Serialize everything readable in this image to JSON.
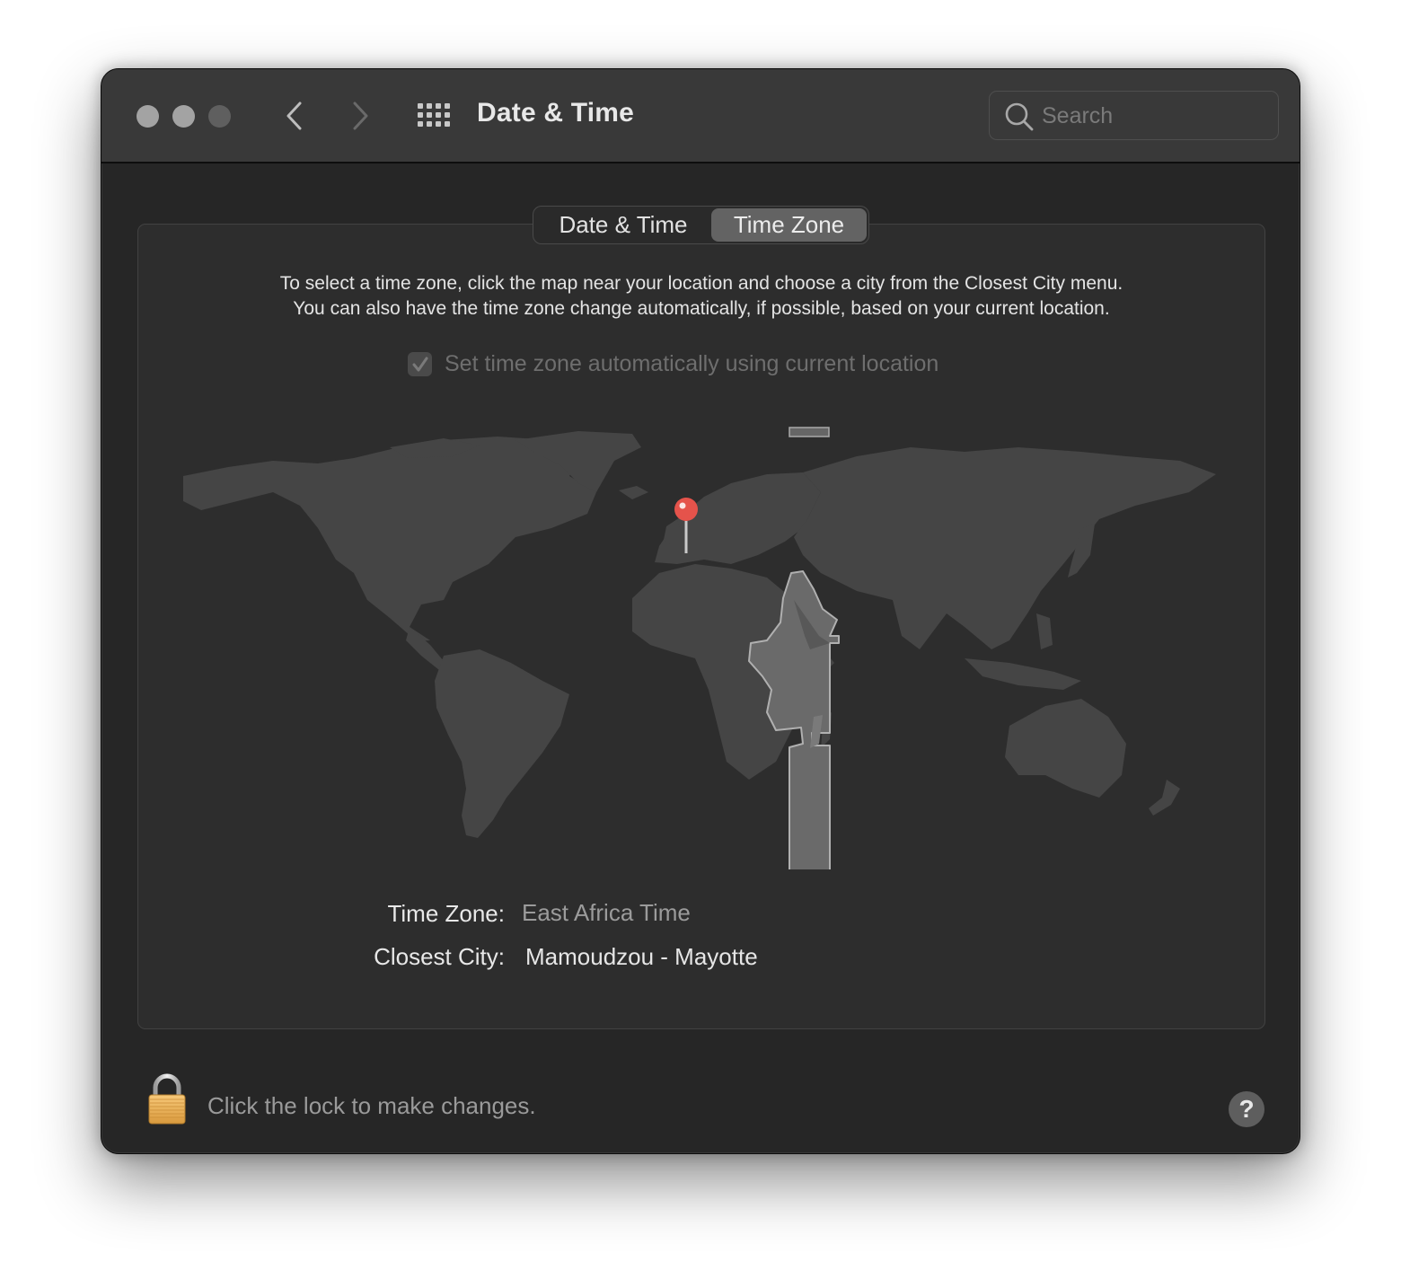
{
  "window": {
    "title": "Date & Time",
    "traffic_lights": [
      "close",
      "minimize",
      "zoom"
    ]
  },
  "toolbar": {
    "back_icon": "chevron-left-icon",
    "forward_icon": "chevron-right-icon",
    "grid_icon": "show-all-grid-icon",
    "search_placeholder": "Search",
    "search_value": ""
  },
  "tabs": [
    {
      "label": "Date & Time",
      "active": false
    },
    {
      "label": "Time Zone",
      "active": true
    }
  ],
  "time_zone_pane": {
    "description_line1": "To select a time zone, click the map near your location and choose a city from the Closest City menu.",
    "description_line2": "You can also have the time zone change automatically, if possible, based on your current location.",
    "auto_checkbox": {
      "label": "Set time zone automatically using current location",
      "checked": true,
      "enabled": false
    },
    "map": {
      "pin_color": "#e5534b",
      "highlight_zone": "East Africa Time"
    },
    "time_zone_label": "Time Zone:",
    "time_zone_value": "East Africa Time",
    "closest_city_label": "Closest City:",
    "closest_city_value": "Mamoudzou - Mayotte"
  },
  "footer": {
    "lock_text": "Click the lock to make changes.",
    "lock_icon": "padlock-icon",
    "help_label": "?"
  },
  "colors": {
    "window_bg": "#262626",
    "titlebar_bg": "#393939",
    "panel_bg": "#2d2d2d",
    "land": "#454545",
    "highlight_zone": "#6a6a6a",
    "pin": "#e5534b"
  }
}
